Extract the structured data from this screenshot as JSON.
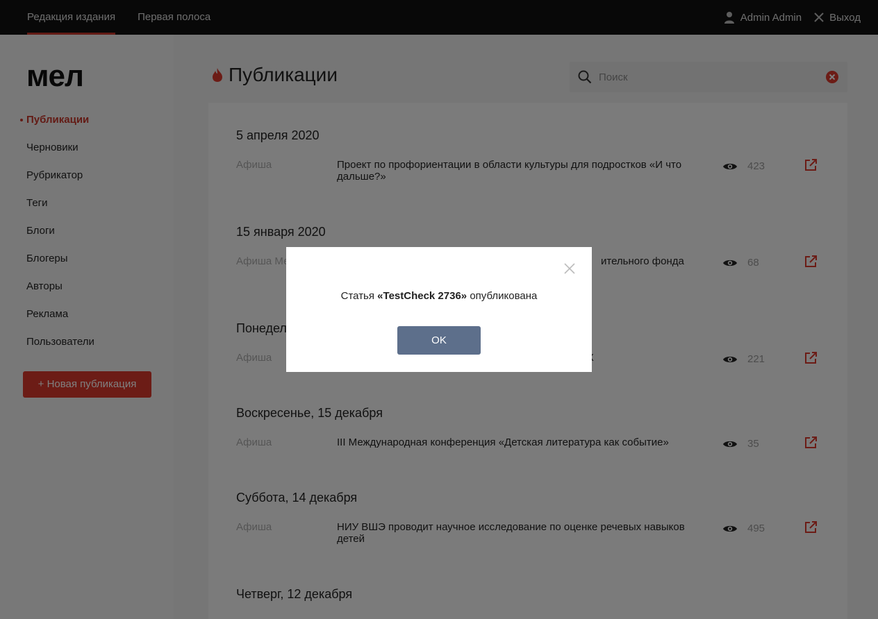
{
  "topbar": {
    "tabs": [
      {
        "label": "Редакция издания",
        "active": true
      },
      {
        "label": "Первая полоса",
        "active": false
      }
    ],
    "user_name": "Admin Admin",
    "logout_label": "Выход"
  },
  "sidebar": {
    "logo": "мел",
    "items": [
      {
        "label": "Публикации",
        "active": true
      },
      {
        "label": "Черновики"
      },
      {
        "label": "Рубрикатор"
      },
      {
        "label": "Теги"
      },
      {
        "label": "Блоги"
      },
      {
        "label": "Блогеры"
      },
      {
        "label": "Авторы"
      },
      {
        "label": "Реклама"
      },
      {
        "label": "Пользователи"
      }
    ],
    "new_button_label": "+ Новая публикация"
  },
  "main": {
    "title": "Публикации",
    "search_placeholder": "Поиск",
    "groups": [
      {
        "date": "5 апреля 2020",
        "rubric": "Афиша",
        "title": "Проект по профориентации в области культуры для подростков «И что дальше?»",
        "views": "423"
      },
      {
        "date": "15 января 2020",
        "rubric": "Афиша Ме",
        "title": "ительного фонда",
        "views": "68"
      },
      {
        "date": "Понедел",
        "rubric": "Афиша",
        "title": "НК",
        "views": "221"
      },
      {
        "date": "Воскресенье, 15 декабря",
        "rubric": "Афиша",
        "title": "III Международная конференция «Детская литература как событие»",
        "views": "35"
      },
      {
        "date": "Суббота, 14 декабря",
        "rubric": "Афиша",
        "title": "НИУ ВШЭ проводит научное исследование по оценке речевых навыков детей",
        "views": "495"
      },
      {
        "date": "Четверг, 12 декабря"
      }
    ]
  },
  "modal": {
    "prefix": "Статья ",
    "article": "«TestCheck 2736»",
    "suffix": " опубликована",
    "ok_label": "OK"
  },
  "colors": {
    "accent": "#d9382c",
    "topbar": "#111111",
    "ok_button": "#5d6f8b"
  }
}
